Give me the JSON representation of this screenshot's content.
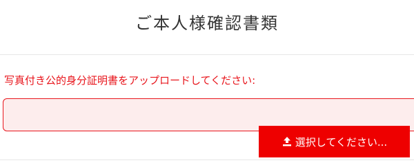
{
  "header": {
    "title": "ご本人様確認書類"
  },
  "upload": {
    "label": "写真付き公的身分証明書をアップロードしてください:",
    "field_value": "",
    "button_label": "選択してください...",
    "button_icon": "upload-icon"
  },
  "colors": {
    "accent": "#ee0000",
    "label": "#e8141b",
    "field_background": "#fdeded"
  }
}
